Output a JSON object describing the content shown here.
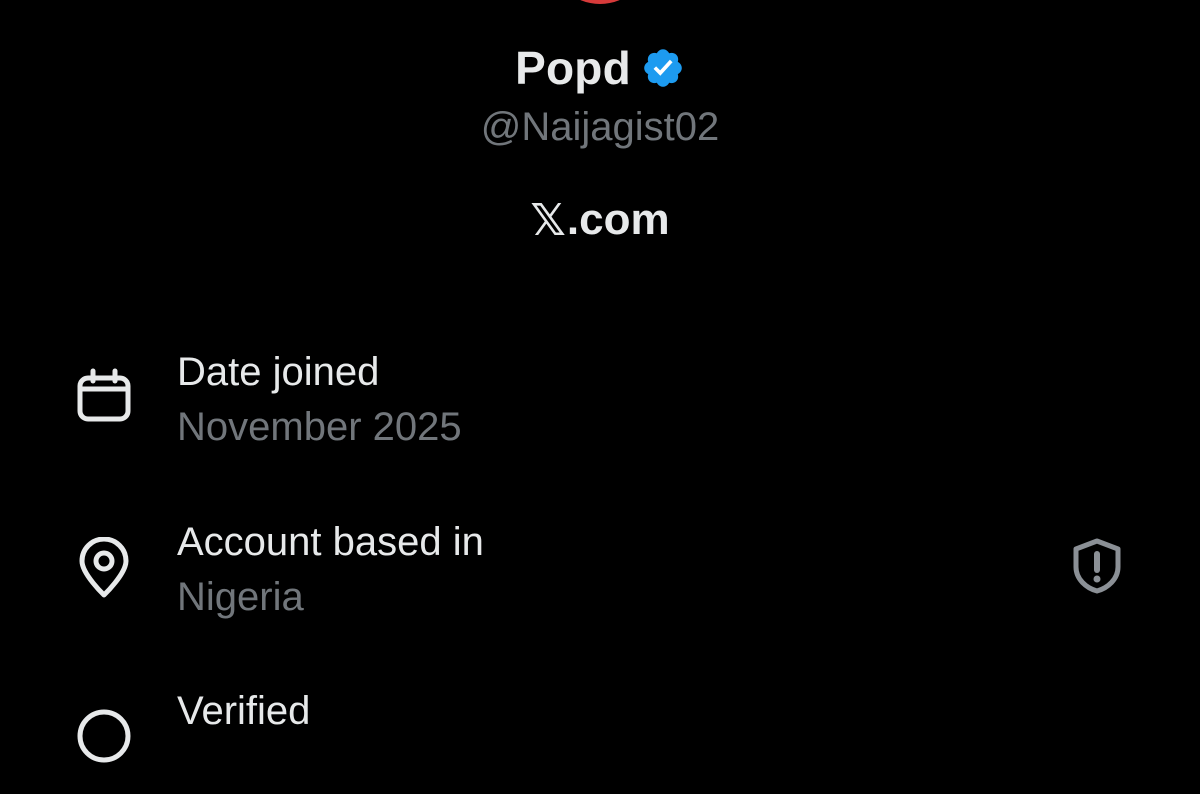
{
  "profile": {
    "display_name": "Popd",
    "handle": "@Naijagist02",
    "site_logo": "𝕏",
    "site_suffix": ".com"
  },
  "about": {
    "rows": [
      {
        "title": "Date joined",
        "value": "November 2025",
        "icon": "calendar-icon"
      },
      {
        "title": "Account based in",
        "value": "Nigeria",
        "icon": "location-pin-icon",
        "trailing_icon": "shield-alert-icon"
      },
      {
        "title": "Verified",
        "value": "",
        "icon": "verified-badge-icon"
      }
    ]
  },
  "colors": {
    "background": "#000000",
    "primary_text": "#e7e9ea",
    "secondary_text": "#71767b",
    "verified_blue": "#1d9bf0",
    "avatar_ring": "#d63a3a"
  }
}
